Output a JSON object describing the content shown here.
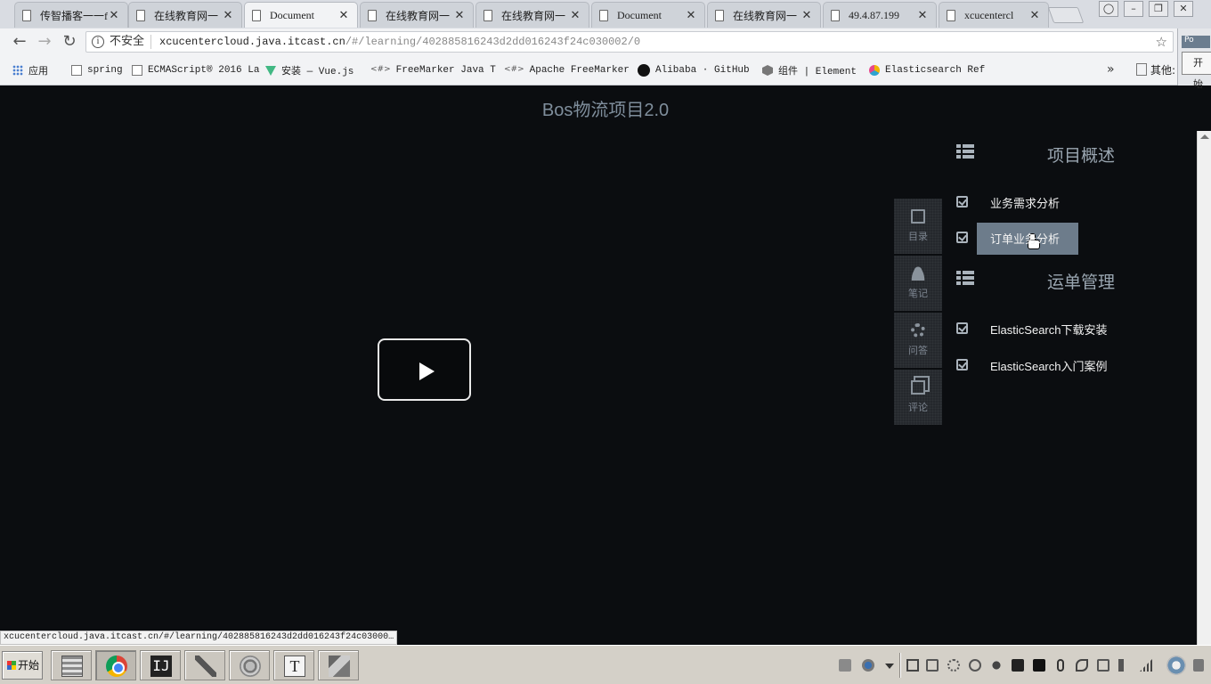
{
  "browser": {
    "tabs": [
      {
        "title": "传智播客一一f"
      },
      {
        "title": "在线教育网一"
      },
      {
        "title": "Document"
      },
      {
        "title": "在线教育网一"
      },
      {
        "title": "在线教育网一"
      },
      {
        "title": "Document"
      },
      {
        "title": "在线教育网一"
      },
      {
        "title": "49.4.87.199"
      },
      {
        "title": "xcucentercl"
      }
    ],
    "address": {
      "security_label": "不安全",
      "host": "xcucentercloud.java.itcast.cn",
      "path": "/#/learning/402885816243d2dd016243f24c030002/0"
    },
    "bookmarks": [
      {
        "label": "应用",
        "icon": "apps-icon"
      },
      {
        "label": "spring",
        "icon": "page-icon"
      },
      {
        "label": "ECMAScript® 2016 La",
        "icon": "page-icon"
      },
      {
        "label": "安装 — Vue.js",
        "icon": "vue-icon"
      },
      {
        "label": "FreeMarker Java Tem",
        "icon": "code-icon"
      },
      {
        "label": "Apache FreeMarker",
        "icon": "code-icon"
      },
      {
        "label": "Alibaba · GitHub",
        "icon": "github-icon"
      },
      {
        "label": "组件 | Element",
        "icon": "element-icon"
      },
      {
        "label": "Elasticsearch Refer",
        "icon": "elastic-icon"
      }
    ],
    "more_bookmarks": "»",
    "other_bookmarks": "其他:",
    "side_panel": {
      "label1": "Po",
      "label2": "开始"
    }
  },
  "page": {
    "course_title": "Bos物流项目2.0",
    "tools": [
      {
        "label": "目录",
        "icon": "book-icon"
      },
      {
        "label": "笔记",
        "icon": "user-icon"
      },
      {
        "label": "问答",
        "icon": "gear-icon"
      },
      {
        "label": "评论",
        "icon": "copy-icon"
      }
    ],
    "chapters": [
      {
        "title": "项目概述",
        "lessons": [
          "业务需求分析",
          "订单业务分析"
        ]
      },
      {
        "title": "运单管理",
        "lessons": [
          "ElasticSearch下载安装",
          "ElasticSearch入门案例"
        ]
      }
    ],
    "hovered_lesson": "订单业务分析",
    "status_url": "xcucentercloud.java.itcast.cn/#/learning/402885816243d2dd016243f24c03000…"
  },
  "taskbar": {
    "start_label": "开始",
    "apps": [
      "files-icon",
      "chrome-icon",
      "intellij-icon",
      "tool-icon",
      "swirl-icon",
      "text-icon",
      "recorder-icon"
    ]
  },
  "colors": {
    "page_bg": "#0b0d10",
    "title_color": "#7f8e9c",
    "highlight": "#6d7c8b"
  }
}
